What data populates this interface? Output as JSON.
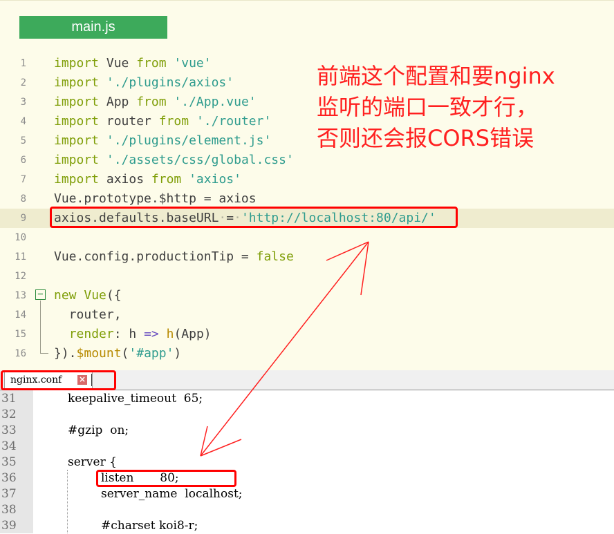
{
  "main_js": {
    "tab_label": "main.js",
    "lines": [
      {
        "num": "1",
        "parts": [
          {
            "t": "import",
            "c": "kw"
          },
          {
            "t": " Vue "
          },
          {
            "t": "from",
            "c": "kw"
          },
          {
            "t": " "
          },
          {
            "t": "'vue'",
            "c": "str"
          }
        ]
      },
      {
        "num": "2",
        "parts": [
          {
            "t": "import",
            "c": "kw"
          },
          {
            "t": " "
          },
          {
            "t": "'./plugins/axios'",
            "c": "str"
          }
        ]
      },
      {
        "num": "3",
        "parts": [
          {
            "t": "import",
            "c": "kw"
          },
          {
            "t": " App "
          },
          {
            "t": "from",
            "c": "kw"
          },
          {
            "t": " "
          },
          {
            "t": "'./App.vue'",
            "c": "str"
          }
        ]
      },
      {
        "num": "4",
        "parts": [
          {
            "t": "import",
            "c": "kw"
          },
          {
            "t": " router "
          },
          {
            "t": "from",
            "c": "kw"
          },
          {
            "t": " "
          },
          {
            "t": "'./router'",
            "c": "str"
          }
        ]
      },
      {
        "num": "5",
        "parts": [
          {
            "t": "import",
            "c": "kw"
          },
          {
            "t": " "
          },
          {
            "t": "'./plugins/element.js'",
            "c": "str"
          }
        ]
      },
      {
        "num": "6",
        "parts": [
          {
            "t": "import",
            "c": "kw"
          },
          {
            "t": " "
          },
          {
            "t": "'./assets/css/global.css'",
            "c": "str"
          }
        ]
      },
      {
        "num": "7",
        "parts": [
          {
            "t": "import",
            "c": "kw"
          },
          {
            "t": " axios "
          },
          {
            "t": "from",
            "c": "kw"
          },
          {
            "t": " "
          },
          {
            "t": "'axios'",
            "c": "str"
          }
        ]
      },
      {
        "num": "8",
        "parts": [
          {
            "t": "Vue.prototype."
          },
          {
            "t": "$http",
            "c": ""
          },
          {
            "t": " = axios"
          }
        ]
      },
      {
        "num": "9",
        "active": true,
        "parts": [
          {
            "t": "axios.defaults.baseURL"
          },
          {
            "t": "·",
            "c": "ws"
          },
          {
            "t": "="
          },
          {
            "t": "·",
            "c": "ws"
          },
          {
            "t": "'http://localhost:80/api/'",
            "c": "str"
          }
        ]
      },
      {
        "num": "10",
        "parts": []
      },
      {
        "num": "11",
        "parts": [
          {
            "t": "Vue.config.productionTip = "
          },
          {
            "t": "false",
            "c": "kw"
          }
        ]
      },
      {
        "num": "12",
        "parts": []
      },
      {
        "num": "13",
        "parts": [
          {
            "t": "new",
            "c": "kw"
          },
          {
            "t": " "
          },
          {
            "t": "Vue",
            "c": "kw"
          },
          {
            "t": "({"
          }
        ]
      },
      {
        "num": "14",
        "parts": [
          {
            "t": "  router,"
          }
        ]
      },
      {
        "num": "15",
        "parts": [
          {
            "t": "  "
          },
          {
            "t": "render",
            "c": "kw"
          },
          {
            "t": ": h "
          },
          {
            "t": "=>",
            "c": "op"
          },
          {
            "t": " "
          },
          {
            "t": "h",
            "c": "pr"
          },
          {
            "t": "(App)"
          }
        ]
      },
      {
        "num": "16",
        "parts": [
          {
            "t": "})."
          },
          {
            "t": "$mount",
            "c": "pr"
          },
          {
            "t": "("
          },
          {
            "t": "'#app'",
            "c": "str"
          },
          {
            "t": ")"
          }
        ]
      }
    ]
  },
  "annotation": {
    "line1": "前端这个配置和要nginx",
    "line2": "监听的端口一致才行，",
    "line3": "否则还会报CORS错误"
  },
  "nginx_conf": {
    "tab_label": "nginx.conf",
    "close_glyph": "×",
    "lines": [
      {
        "num": "31",
        "code": "keepalive_timeout  65;",
        "indent": 1
      },
      {
        "num": "32",
        "code": "",
        "indent": 1
      },
      {
        "num": "33",
        "code": "#gzip  on;",
        "indent": 1
      },
      {
        "num": "34",
        "code": "",
        "indent": 1
      },
      {
        "num": "35",
        "code": "server {",
        "indent": 1
      },
      {
        "num": "36",
        "code": "listen       80;",
        "indent": 2
      },
      {
        "num": "37",
        "code": "server_name  localhost;",
        "indent": 2
      },
      {
        "num": "38",
        "code": "",
        "indent": 2
      },
      {
        "num": "39",
        "code": "#charset koi8-r;",
        "indent": 2
      }
    ]
  },
  "colors": {
    "annotation_red": "#ff2020",
    "tab_green": "#3daa5b",
    "keyword": "#7f9e08",
    "string": "#2f9c8e"
  }
}
